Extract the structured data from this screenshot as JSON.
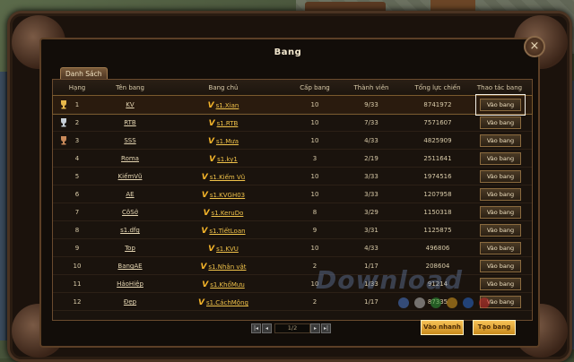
{
  "window": {
    "title": "Bang"
  },
  "tab": {
    "label": "Danh Sách"
  },
  "columns": [
    "Hạng",
    "Tên bang",
    "Bang chủ",
    "Cấp bang",
    "Thành viên",
    "Tổng lực chiến",
    "Thao tác bang"
  ],
  "rows": [
    {
      "rank": "1",
      "name": "KV",
      "leader": "s1.Xian",
      "level": "10",
      "members": "9/33",
      "power": "8741972",
      "action": "Vào bang",
      "icon": "gold-trophy-icon",
      "selected": true
    },
    {
      "rank": "2",
      "name": "RTB",
      "leader": "s1.RTB",
      "level": "10",
      "members": "7/33",
      "power": "7571607",
      "action": "Vào bang",
      "icon": "silver-trophy-icon"
    },
    {
      "rank": "3",
      "name": "SSS",
      "leader": "s1.Mưa",
      "level": "10",
      "members": "4/33",
      "power": "4825909",
      "action": "Vào bang",
      "icon": "bronze-trophy-icon"
    },
    {
      "rank": "4",
      "name": "Roma",
      "leader": "s1.ky1",
      "level": "3",
      "members": "2/19",
      "power": "2511641",
      "action": "Vào bang"
    },
    {
      "rank": "5",
      "name": "KiếmVũ",
      "leader": "s1.Kiếm Vũ",
      "level": "10",
      "members": "3/33",
      "power": "1974516",
      "action": "Vào bang"
    },
    {
      "rank": "6",
      "name": "AE",
      "leader": "s1.KVGH03",
      "level": "10",
      "members": "3/33",
      "power": "1207958",
      "action": "Vào bang"
    },
    {
      "rank": "7",
      "name": "CôSở",
      "leader": "s1.KeruDo",
      "level": "8",
      "members": "3/29",
      "power": "1150318",
      "action": "Vào bang"
    },
    {
      "rank": "8",
      "name": "s1.dfg",
      "leader": "s1.TiếtLoan",
      "level": "9",
      "members": "3/31",
      "power": "1125875",
      "action": "Vào bang"
    },
    {
      "rank": "9",
      "name": "Top",
      "leader": "s1.KVU",
      "level": "10",
      "members": "4/33",
      "power": "496806",
      "action": "Vào bang"
    },
    {
      "rank": "10",
      "name": "BangAE",
      "leader": "s1.Nhân vật",
      "level": "2",
      "members": "1/17",
      "power": "208604",
      "action": "Vào bang"
    },
    {
      "rank": "11",
      "name": "HảoHiệp",
      "leader": "s1.KhổMưu",
      "level": "10",
      "members": "1/33",
      "power": "91214",
      "action": "Vào bang"
    },
    {
      "rank": "12",
      "name": "Đẹp",
      "leader": "s1.CáchMộng",
      "level": "2",
      "members": "1/17",
      "power": "87335",
      "action": "Vào bang"
    }
  ],
  "pagination": {
    "page": "1/2"
  },
  "buttons": {
    "quick_join": "Vào nhanh",
    "create": "Tạo bang"
  },
  "watermark": "Download",
  "colors": {
    "accent_gold": "#f0c24a",
    "button_gold": "#e8a93a",
    "frame": "#4a3322"
  }
}
